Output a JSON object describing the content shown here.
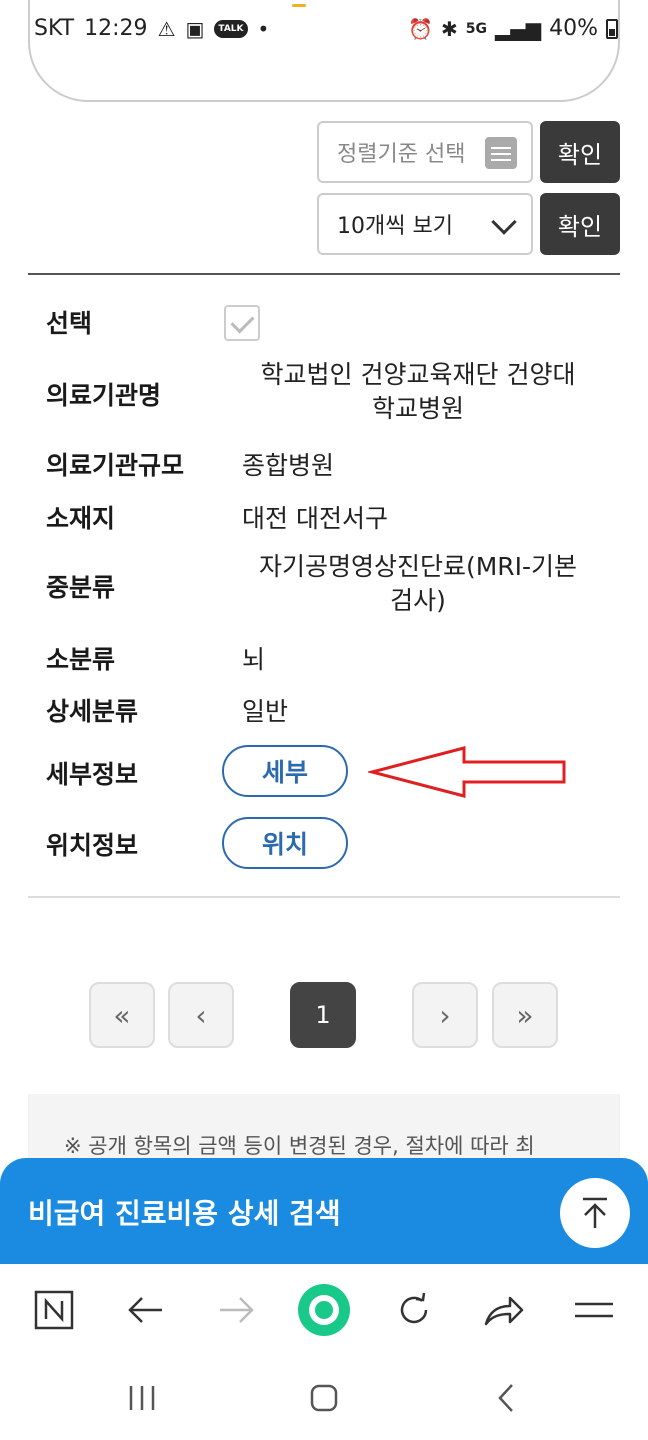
{
  "status_bar": {
    "carrier": "SKT",
    "time": "12:29",
    "battery": "40%",
    "icons": [
      "warning-icon",
      "image-icon",
      "talk-icon",
      "alarm-icon",
      "bluetooth-icon",
      "5g-icon",
      "signal-icon",
      "battery-icon"
    ],
    "talk_label": "TALK",
    "network_label": "5G"
  },
  "sort": {
    "placeholder": "정렬기준 선택",
    "confirm_label": "확인"
  },
  "page_size": {
    "selected": "10개씩 보기",
    "confirm_label": "확인"
  },
  "detail": {
    "select_label": "선택",
    "institution_label": "의료기관명",
    "institution_line1": "학교법인 건양교육재단 건양대",
    "institution_line2": "학교병원",
    "scale_label": "의료기관규모",
    "scale_value": "종합병원",
    "location_label": "소재지",
    "location_value": "대전 대전서구",
    "mid_category_label": "중분류",
    "mid_category_line1": "자기공명영상진단료(MRI-기본",
    "mid_category_line2": "검사)",
    "sub_category_label": "소분류",
    "sub_category_value": "뇌",
    "detail_category_label": "상세분류",
    "detail_category_value": "일반",
    "detail_info_label": "세부정보",
    "detail_button": "세부",
    "location_info_label": "위치정보",
    "location_button": "위치"
  },
  "pagination": {
    "first": "«",
    "prev": "‹",
    "current": "1",
    "next": "›",
    "last": "»"
  },
  "notice": {
    "text": "※ 공개 항목의 금액 등이 변경된 경우, 절차에 따라 최"
  },
  "bottom_bar": {
    "title": "비급여 진료비용 상세 검색",
    "color": "#1a8be0"
  },
  "annotation": {
    "arrow_color": "#e02020"
  },
  "browser_toolbar": {
    "items": [
      "naver-icon",
      "back-icon",
      "forward-icon",
      "home-green-icon",
      "refresh-icon",
      "share-icon",
      "menu-icon"
    ]
  },
  "system_nav": {
    "items": [
      "recent-apps-icon",
      "home-icon",
      "back-nav-icon"
    ]
  }
}
